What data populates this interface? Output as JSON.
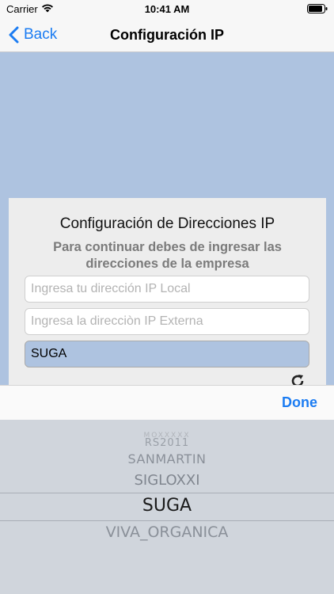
{
  "status_bar": {
    "carrier": "Carrier",
    "time": "10:41 AM"
  },
  "nav": {
    "back_label": "Back",
    "title": "Configuración IP"
  },
  "card": {
    "title": "Configuración de Direcciones IP",
    "subtitle": "Para continuar debes de ingresar las direcciones de la empresa",
    "local_ip": {
      "placeholder": "Ingresa tu dirección IP Local",
      "value": ""
    },
    "external_ip": {
      "placeholder": "Ingresa la direcciòn IP Externa",
      "value": ""
    },
    "company": {
      "value": "SUGA"
    }
  },
  "picker": {
    "done_label": "Done",
    "faint_item": "MOXXXXX",
    "items": [
      "RS2011",
      "SANMARTIN",
      "SIGLOXXI",
      "SUGA",
      "VIVA_ORGANICA"
    ],
    "selected": "SUGA"
  },
  "colors": {
    "accent": "#1b7cf2",
    "background_blue": "#aec3e0",
    "picker_bg": "#d0d5dc"
  }
}
